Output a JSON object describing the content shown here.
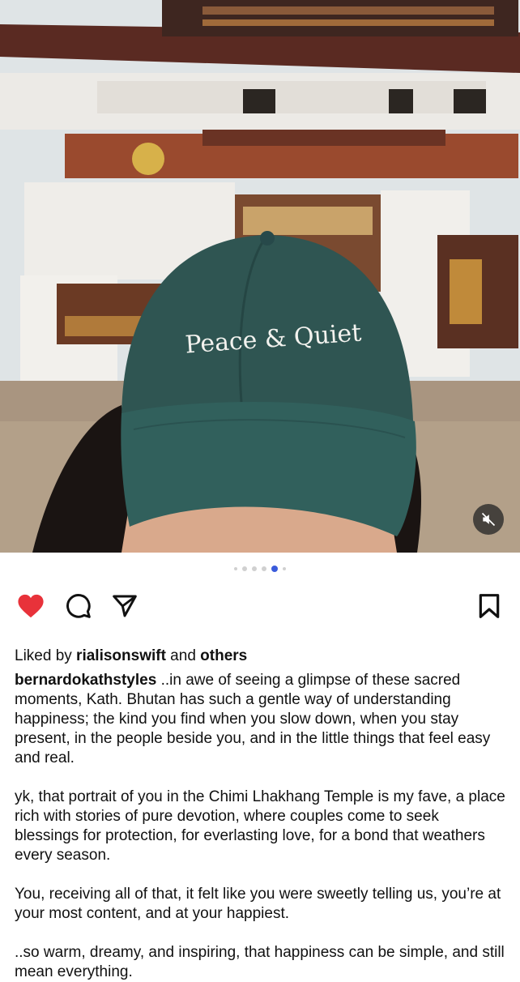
{
  "post": {
    "cap_text": "Peace & Quiet",
    "carousel": {
      "count": 6,
      "active_index": 4
    },
    "liked_by_prefix": "Liked by ",
    "liked_by_user": "rialisonswift",
    "liked_by_and": " and ",
    "liked_by_others": "others",
    "caption_user": "bernardokathstyles",
    "caption_paragraphs": [
      " ..in awe of seeing a glimpse of these sacred moments, Kath. Bhutan has such a gentle way of understanding happiness; the kind you find when you slow down, when you stay present, in the people beside you, and in the little things that feel easy and real.",
      "yk, that portrait of you in the Chimi Lhakhang Temple is my fave, a place rich with stories of pure devotion, where couples come to seek blessings for protection, for everlasting love, for a bond that weathers every season.",
      "You, receiving all of that, it felt like you were sweetly telling us, you’re at your most content, and at your happiest.",
      "..so warm, dreamy, and inspiring, that happiness can be simple, and still mean everything."
    ]
  },
  "colors": {
    "heart": "#e8323a",
    "active_dot": "#3b5bdb",
    "cap": "#2a4d4a"
  },
  "icons": {
    "mute": "speaker-muted-icon",
    "like": "heart-icon",
    "comment": "comment-icon",
    "share": "paper-plane-icon",
    "save": "bookmark-icon"
  }
}
